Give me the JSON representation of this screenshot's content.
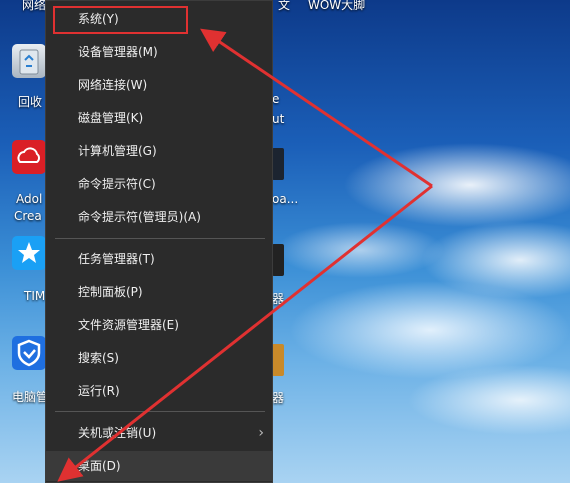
{
  "desktop": {
    "top_texts": [
      "网络",
      "文",
      "WOW大脚"
    ],
    "icons": [
      {
        "name": "recycle-bin-icon",
        "label": "回收"
      },
      {
        "name": "adobe-cloud-icon",
        "label": "Adol"
      },
      {
        "name": "tim-icon",
        "label": "TIM"
      },
      {
        "name": "security-icon",
        "label": "电脑管"
      }
    ],
    "adobe_second_line": "Crea",
    "right_labels": [
      "e",
      "ut",
      "oa...",
      "器",
      "器"
    ]
  },
  "context_menu": {
    "items": [
      {
        "label": "系统(Y)"
      },
      {
        "label": "设备管理器(M)"
      },
      {
        "label": "网络连接(W)"
      },
      {
        "label": "磁盘管理(K)"
      },
      {
        "label": "计算机管理(G)"
      },
      {
        "label": "命令提示符(C)"
      },
      {
        "label": "命令提示符(管理员)(A)"
      },
      {
        "label": "任务管理器(T)"
      },
      {
        "label": "控制面板(P)"
      },
      {
        "label": "文件资源管理器(E)"
      },
      {
        "label": "搜索(S)"
      },
      {
        "label": "运行(R)"
      },
      {
        "label": "关机或注销(U)"
      },
      {
        "label": "桌面(D)"
      }
    ]
  },
  "annotation": {
    "color": "#e03131"
  }
}
